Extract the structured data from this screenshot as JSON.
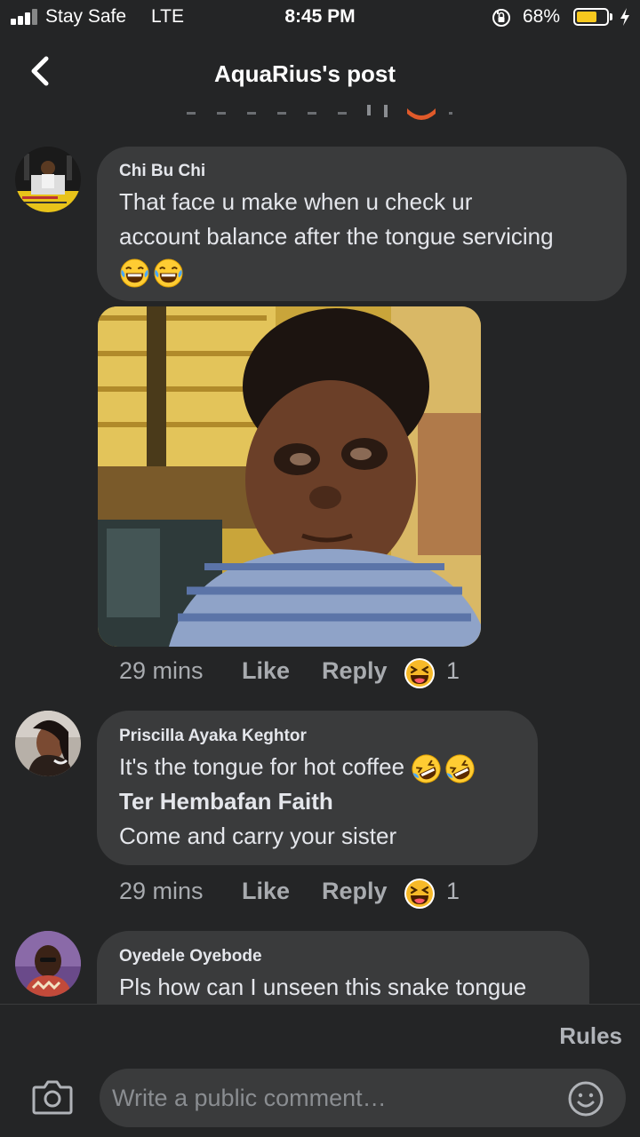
{
  "status_bar": {
    "carrier": "Stay Safe",
    "network": "LTE",
    "time": "8:45 PM",
    "battery_percent": "68%",
    "battery_level": 0.68,
    "signal_icon": "signal-bars-icon",
    "orientation_lock_icon": "orientation-lock-icon",
    "charging_icon": "bolt-icon"
  },
  "header": {
    "title": "AquaRius's post",
    "back_icon": "chevron-left-icon"
  },
  "comments": [
    {
      "author": "Chi Bu Chi",
      "text_lines": [
        "That face u make when u check ur",
        "account balance after the tongue servicing"
      ],
      "emojis": [
        "tears-of-joy-emoji",
        "tears-of-joy-emoji"
      ],
      "image": "photo of a child with a dazed expression",
      "time": "29 mins",
      "like_label": "Like",
      "reply_label": "Reply",
      "reaction_icon": "laughing-reaction-icon",
      "reaction_count": "1"
    },
    {
      "author": "Priscilla Ayaka Keghtor",
      "text": "It's the tongue for hot coffee",
      "emojis": [
        "rolling-laughing-emoji",
        "rolling-laughing-emoji"
      ],
      "mention": "Ter Hembafan Faith",
      "text2": "Come and carry your sister",
      "time": "29 mins",
      "like_label": "Like",
      "reply_label": "Reply",
      "reaction_icon": "laughing-reaction-icon",
      "reaction_count": "1"
    },
    {
      "author": "Oyedele Oyebode",
      "text": "Pls how can I unseen this snake tongue"
    }
  ],
  "footer": {
    "rules_label": "Rules",
    "input_placeholder": "Write a public comment…",
    "camera_icon": "camera-icon",
    "emoji_icon": "smiley-icon"
  },
  "colors": {
    "background": "#242526",
    "bubble": "#3a3b3c",
    "text": "#e4e6eb",
    "muted": "#a8abaf",
    "battery": "#f7c81e",
    "emoji_yellow": "#ffcc33"
  }
}
